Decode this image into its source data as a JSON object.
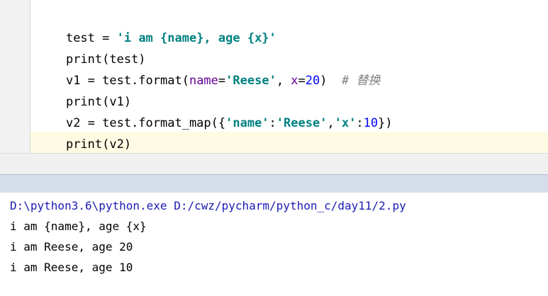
{
  "editor": {
    "lines": [
      {
        "segments": [
          {
            "text": "test = ",
            "kind": "plain"
          },
          {
            "text": "'i am {name}, age {x}'",
            "kind": "str"
          }
        ]
      },
      {
        "segments": [
          {
            "text": "print(test)",
            "kind": "plain"
          }
        ]
      },
      {
        "segments": [
          {
            "text": "v1 = test.format(",
            "kind": "plain"
          },
          {
            "text": "name",
            "kind": "param"
          },
          {
            "text": "=",
            "kind": "plain"
          },
          {
            "text": "'Reese'",
            "kind": "str"
          },
          {
            "text": ", ",
            "kind": "plain"
          },
          {
            "text": "x",
            "kind": "param"
          },
          {
            "text": "=",
            "kind": "plain"
          },
          {
            "text": "20",
            "kind": "num"
          },
          {
            "text": ")  ",
            "kind": "plain"
          },
          {
            "text": "# 替换",
            "kind": "comment"
          }
        ]
      },
      {
        "segments": [
          {
            "text": "print(v1)",
            "kind": "plain"
          }
        ]
      },
      {
        "segments": [
          {
            "text": "v2 = test.format_map({",
            "kind": "plain"
          },
          {
            "text": "'name'",
            "kind": "str"
          },
          {
            "text": ":",
            "kind": "plain"
          },
          {
            "text": "'Reese'",
            "kind": "str"
          },
          {
            "text": ",",
            "kind": "plain"
          },
          {
            "text": "'x'",
            "kind": "str"
          },
          {
            "text": ":",
            "kind": "plain"
          },
          {
            "text": "10",
            "kind": "num"
          },
          {
            "text": "})",
            "kind": "plain"
          }
        ]
      },
      {
        "segments": [
          {
            "text": "print(v2)",
            "kind": "plain"
          }
        ]
      }
    ]
  },
  "console": {
    "command": "D:\\python3.6\\python.exe D:/cwz/pycharm/python_c/day11/2.py",
    "outputs": [
      "i am {name}, age {x}",
      "i am Reese, age 20",
      "i am Reese, age 10"
    ]
  },
  "colors": {
    "string": "#008080",
    "param": "#660099",
    "number": "#0000ff",
    "comment": "#808080",
    "console_command": "#1b1bb3",
    "current_line": "#fffae3",
    "panel_header": "#d5dcea"
  }
}
